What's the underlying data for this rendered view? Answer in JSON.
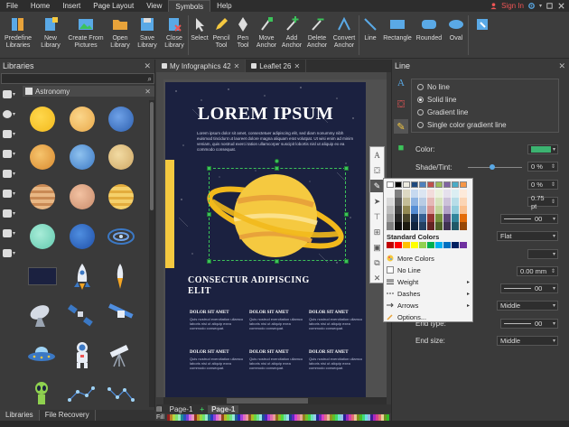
{
  "menu": {
    "items": [
      "File",
      "Home",
      "Insert",
      "Page Layout",
      "View",
      "Symbols",
      "Help"
    ],
    "active": "Symbols",
    "sign_in": "Sign In"
  },
  "ribbon": {
    "buttons": [
      {
        "label": "Predefine\nLibraries",
        "icon": "library-icon"
      },
      {
        "label": "New\nLibrary",
        "icon": "new-library-icon"
      },
      {
        "label": "Create From\nPictures",
        "icon": "picture-icon"
      },
      {
        "label": "Open\nLibrary",
        "icon": "folder-open-icon"
      },
      {
        "label": "Save\nLibrary",
        "icon": "save-icon"
      },
      {
        "label": "Close\nLibrary",
        "icon": "close-library-icon"
      },
      {
        "label": "Select",
        "icon": "cursor-icon"
      },
      {
        "label": "Pencil\nTool",
        "icon": "pencil-icon"
      },
      {
        "label": "Pen\nTool",
        "icon": "pen-icon"
      },
      {
        "label": "Move\nAnchor",
        "icon": "move-anchor-icon"
      },
      {
        "label": "Add\nAnchor",
        "icon": "add-anchor-icon"
      },
      {
        "label": "Delete\nAnchor",
        "icon": "delete-anchor-icon"
      },
      {
        "label": "Convert\nAnchor",
        "icon": "convert-anchor-icon"
      },
      {
        "label": "Line",
        "icon": "line-icon"
      },
      {
        "label": "Rectangle",
        "icon": "rectangle-icon"
      },
      {
        "label": "Rounded",
        "icon": "rounded-rectangle-icon"
      },
      {
        "label": "Oval",
        "icon": "oval-icon"
      }
    ]
  },
  "libraries": {
    "title": "Libraries",
    "category": "Astronomy",
    "tabs": [
      "Libraries",
      "File Recovery"
    ]
  },
  "document": {
    "tabs": [
      "My Infographics 42",
      "Leaflet 26"
    ],
    "title": "LOREM IPSUM",
    "body": "Lorem ipsum dolor sit amet, consectetuer adipiscing elit, sed diam nonummy nibh euismod tincidunt ut laoreet dolore magna aliquam erat volutpat. Ut wisi enim ad minim veniam, quis nostrud exerci tation ullamcorper suscipit lobortis nisl ut aliquip ex ea commodo consequat.",
    "subtitle": "CONSECTUR ADIPISCING ELIT",
    "columns": [
      {
        "head": "DOLOR SIT AMET",
        "text": "Quis nostrud exercitation ullamco laboris nisi ut aliquip exea commodo consequat."
      },
      {
        "head": "DOLOR SIT AMET",
        "text": "Quis nostrud exercitation ullamco laboris nisi ut aliquip exea commodo consequat."
      },
      {
        "head": "DOLOR SIT AMET",
        "text": "Quis nostrud exercitation ullamco laboris nisi ut aliquip exea commodo consequat."
      },
      {
        "head": "DOLOR SIT AMET",
        "text": "Quis nostrud exercitation ullamco laboris nisi ut aliquip exea commodo consequat."
      },
      {
        "head": "DOLOR SIT AMET",
        "text": "Quis nostrud exercitation ullamco laboris nisi ut aliquip exea commodo consequat."
      },
      {
        "head": "DOLOR SIT AMET",
        "text": "Quis nostrud exercitation ullamco laboris nisi ut aliquip exea commodo consequat."
      }
    ],
    "pages": [
      "Page-1",
      "Page-1"
    ],
    "fill_label": "Fill"
  },
  "line_panel": {
    "title": "Line",
    "options": [
      "No line",
      "Solid line",
      "Gradient line",
      "Single color gradient line"
    ],
    "selected": "Solid line",
    "color_label": "Color:",
    "color_value": "#3cb371",
    "shade_label": "Shade/Tint:",
    "shade_value": "0 %",
    "transparency_value": "0 %",
    "width_value": "0.75 pt",
    "dash_value": "00",
    "cap_value": "Flat",
    "join_value": "",
    "compound_value": "0.00 mm",
    "begin_type_value": "00",
    "begin_size_value": "Middle",
    "end_type_label": "End type:",
    "end_type_value": "00",
    "end_size_label": "End size:",
    "end_size_value": "Middle"
  },
  "color_popup": {
    "standard_label": "Standard Colors",
    "items": [
      {
        "label": "More Colors",
        "icon": "palette-icon",
        "submenu": false
      },
      {
        "label": "No Line",
        "icon": "no-line-icon",
        "submenu": false
      },
      {
        "label": "Weight",
        "icon": "weight-icon",
        "submenu": true
      },
      {
        "label": "Dashes",
        "icon": "dashes-icon",
        "submenu": true
      },
      {
        "label": "Arrows",
        "icon": "arrows-icon",
        "submenu": true
      },
      {
        "label": "Options...",
        "icon": "options-icon",
        "submenu": false
      }
    ]
  },
  "colors": {
    "accent": "#3cc35a",
    "page_bg": "#1b2140",
    "planet": "#f5c940",
    "sign_in": "#e55555"
  }
}
